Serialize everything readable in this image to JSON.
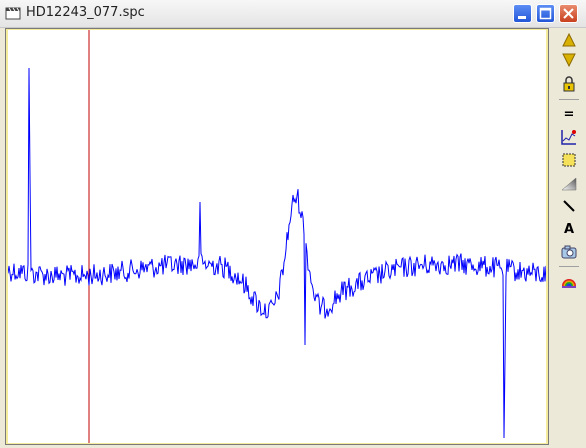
{
  "window": {
    "title": "HD12243_077.spc"
  },
  "colors": {
    "spectrum": "#0000ff",
    "cursor_line": "#c00000",
    "plot_background": "#ffffff",
    "frame": "#f4ec9a"
  },
  "toolbar": {
    "items": [
      {
        "icon": "scroll-up-icon"
      },
      {
        "icon": "scroll-down-icon"
      },
      {
        "icon": "lock-icon"
      },
      {
        "icon": "equals-icon",
        "label": "="
      },
      {
        "icon": "graph-icon"
      },
      {
        "icon": "select-region-icon"
      },
      {
        "icon": "gradient-icon"
      },
      {
        "icon": "line-tool-icon"
      },
      {
        "icon": "text-tool-icon",
        "label": "A"
      },
      {
        "icon": "camera-icon"
      },
      {
        "icon": "color-palette-icon"
      }
    ]
  }
}
